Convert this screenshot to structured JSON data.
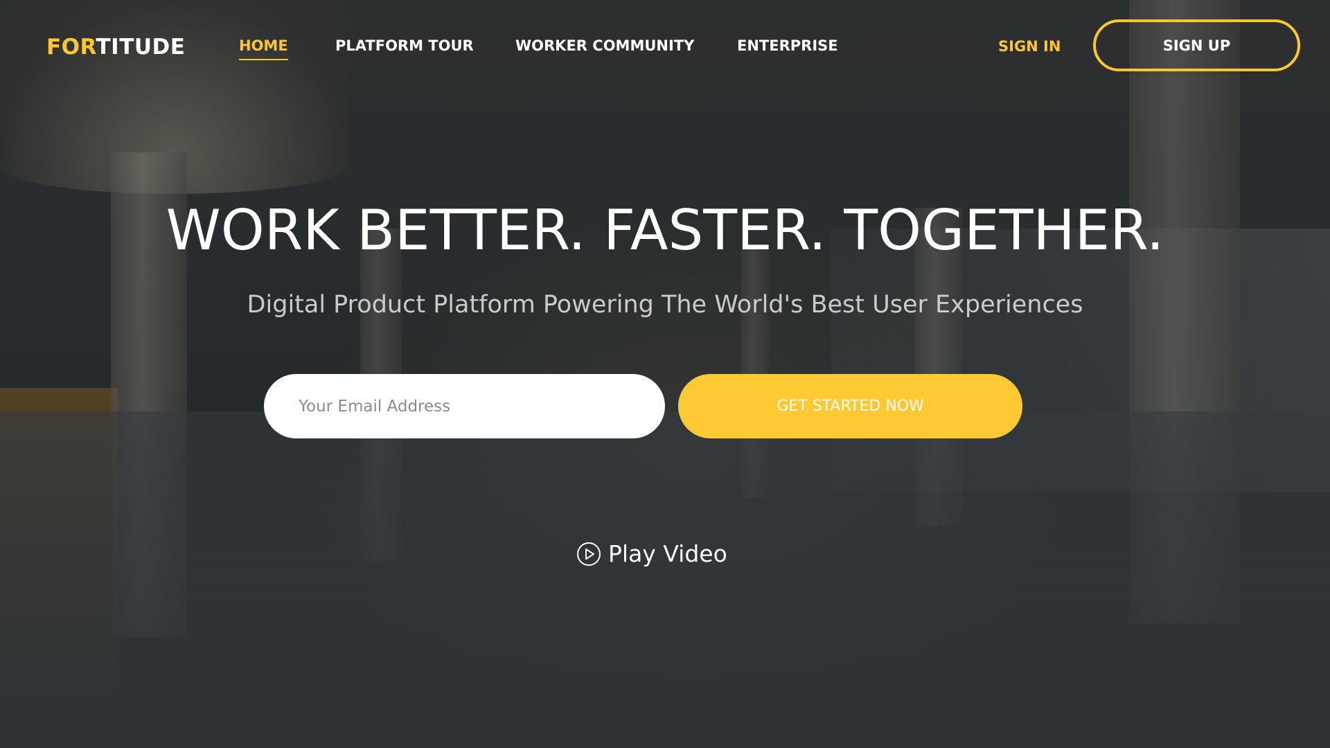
{
  "brand": {
    "logo_accent": "FOR",
    "logo_rest": "TITUDE",
    "accent_color": "#ffc72c"
  },
  "nav": {
    "items": [
      {
        "label": "HOME",
        "active": true
      },
      {
        "label": "PLATFORM TOUR",
        "active": false
      },
      {
        "label": "WORKER COMMUNITY",
        "active": false
      },
      {
        "label": "ENTERPRISE",
        "active": false
      }
    ]
  },
  "auth": {
    "sign_in_label": "SIGN IN",
    "sign_up_label": "SIGN UP"
  },
  "hero": {
    "title": "WORK BETTER.  FASTER.  TOGETHER.",
    "subtitle": "Digital Product Platform Powering The World's Best User Experiences",
    "email_placeholder": "Your Email Address",
    "cta_label": "GET STARTED NOW",
    "play_label": "Play Video",
    "play_icon": "play-circle-icon"
  }
}
